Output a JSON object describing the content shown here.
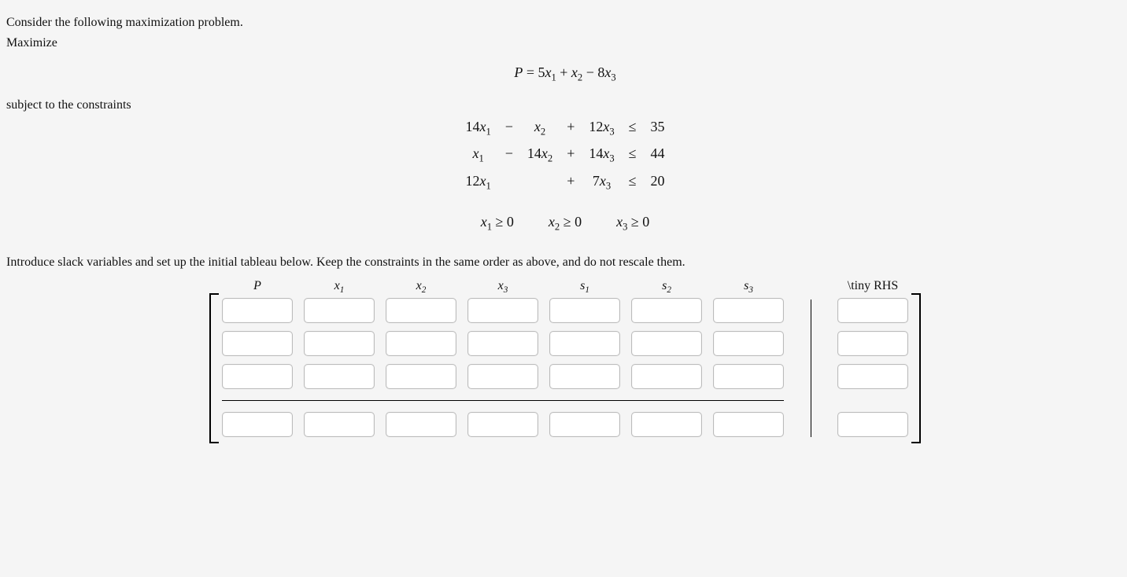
{
  "intro": "Consider the following maximization problem.",
  "maximize_label": "Maximize",
  "objective_html": "P = 5x<span class='sub'>1</span> + x<span class='sub'>2</span> − 8x<span class='sub'>3</span>",
  "subject_label": "subject to the constraints",
  "constraints": [
    [
      "14x1",
      "−",
      "x2",
      "+",
      "12x3",
      "≤",
      "35"
    ],
    [
      "x1",
      "−",
      "14x2",
      "+",
      "14x3",
      "≤",
      "44"
    ],
    [
      "12x1",
      "",
      "",
      "+",
      "7x3",
      "≤",
      "20"
    ]
  ],
  "nonneg": [
    "x1 ≥ 0",
    "x2 ≥ 0",
    "x3 ≥ 0"
  ],
  "instruction": "Introduce slack variables and set up the initial tableau below. Keep the constraints in the same order as above, and do not rescale them.",
  "headers": [
    "P",
    "x1",
    "x2",
    "x3",
    "s1",
    "s2",
    "s3",
    "\\tiny RHS"
  ]
}
